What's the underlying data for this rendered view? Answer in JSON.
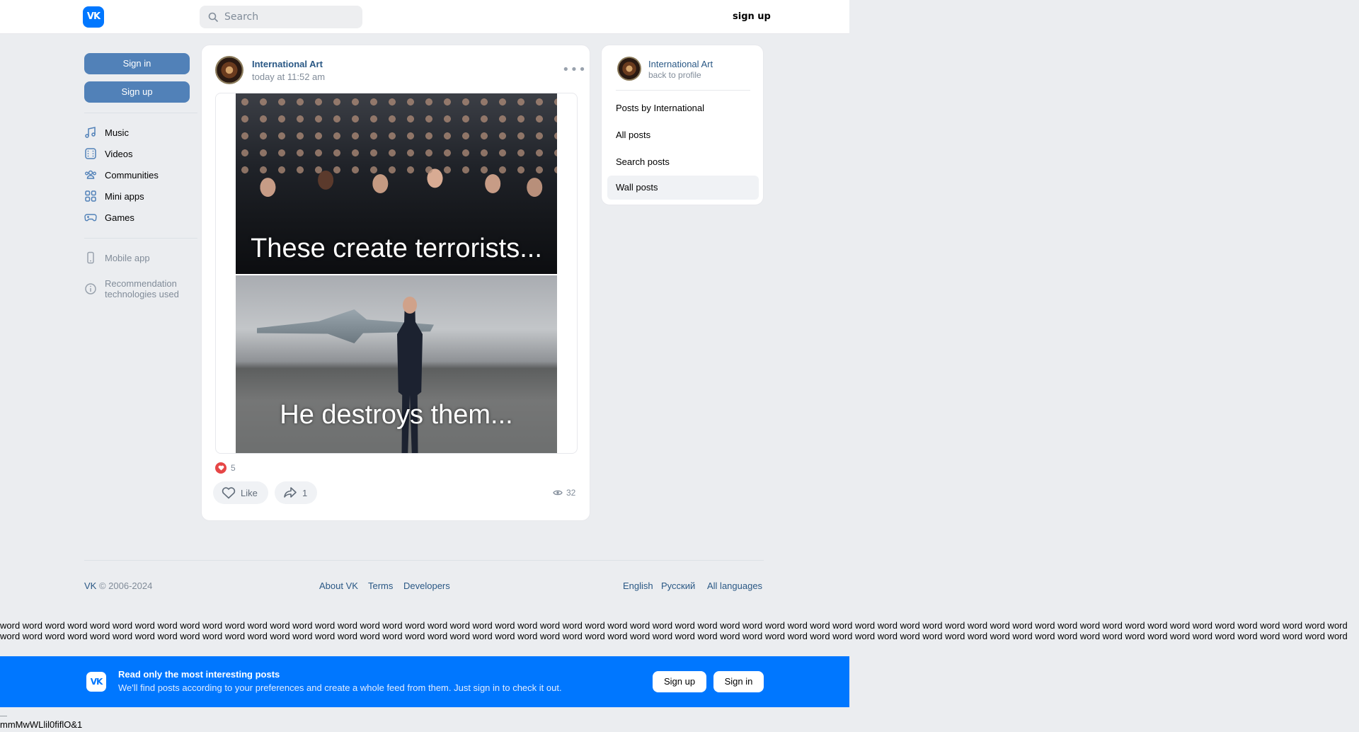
{
  "header": {
    "logo_text": "VK",
    "search_placeholder": "Search",
    "signup_label": "sign up"
  },
  "sidebar": {
    "signin_label": "Sign in",
    "signup_label": "Sign up",
    "items": [
      {
        "label": "Music",
        "icon": "music-icon"
      },
      {
        "label": "Videos",
        "icon": "video-icon"
      },
      {
        "label": "Communities",
        "icon": "communities-icon"
      },
      {
        "label": "Mini apps",
        "icon": "mini-apps-icon"
      },
      {
        "label": "Games",
        "icon": "games-icon"
      }
    ],
    "mobile_app": "Mobile app",
    "recommendation": "Recommendation technologies used"
  },
  "post": {
    "author": "International Art",
    "date": "today at 11:52 am",
    "meme_top_text": "These create terrorists...",
    "meme_bottom_text": "He destroys them...",
    "reactions_count": "5",
    "like_label": "Like",
    "shares_count": "1",
    "views_count": "32"
  },
  "right_card": {
    "name": "International Art",
    "back_label": "back to profile",
    "items": [
      {
        "label": "Posts by International",
        "active": false
      },
      {
        "label": "All posts",
        "active": false
      },
      {
        "label": "Search posts",
        "active": false
      },
      {
        "label": "Wall posts",
        "active": true
      }
    ]
  },
  "footer": {
    "copyright": "VK © 2006-2024",
    "links": [
      "About VK",
      "Terms",
      "Developers"
    ],
    "languages": [
      "English",
      "Русский",
      "All languages"
    ]
  },
  "filler_word": "word",
  "banner": {
    "title": "Read only the most interesting posts",
    "subtitle": "We'll find posts according to your preferences and create a whole feed from them. Just sign in to check it out.",
    "signup_label": "Sign up",
    "signin_label": "Sign in"
  },
  "bottom_text": "mmMwWLlil0fiflO&1",
  "colors": {
    "accent": "#0077ff",
    "button": "#5181b8",
    "link": "#2a5885",
    "background": "#ebedf0"
  }
}
